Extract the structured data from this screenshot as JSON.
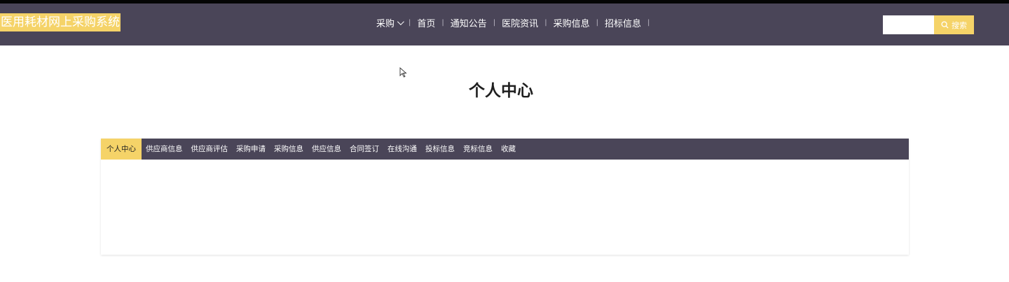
{
  "header": {
    "brand": "医用耗材网上采购系统",
    "nav": [
      {
        "label": "采购",
        "has_dropdown": true
      },
      {
        "label": "首页"
      },
      {
        "label": "通知公告"
      },
      {
        "label": "医院资讯"
      },
      {
        "label": "采购信息"
      },
      {
        "label": "招标信息"
      }
    ],
    "search": {
      "value": "",
      "placeholder": "",
      "button_label": "搜索"
    }
  },
  "page": {
    "title": "个人中心"
  },
  "tabs": [
    {
      "label": "个人中心",
      "active": true
    },
    {
      "label": "供应商信息"
    },
    {
      "label": "供应商评估"
    },
    {
      "label": "采购申请"
    },
    {
      "label": "采购信息"
    },
    {
      "label": "供应信息"
    },
    {
      "label": "合同签订"
    },
    {
      "label": "在线沟通"
    },
    {
      "label": "投标信息"
    },
    {
      "label": "竞标信息"
    },
    {
      "label": "收藏"
    }
  ],
  "colors": {
    "header_bg": "#4a4558",
    "accent": "#f5d368",
    "text_light": "#ffffff",
    "title_text": "#1f1f1f"
  }
}
